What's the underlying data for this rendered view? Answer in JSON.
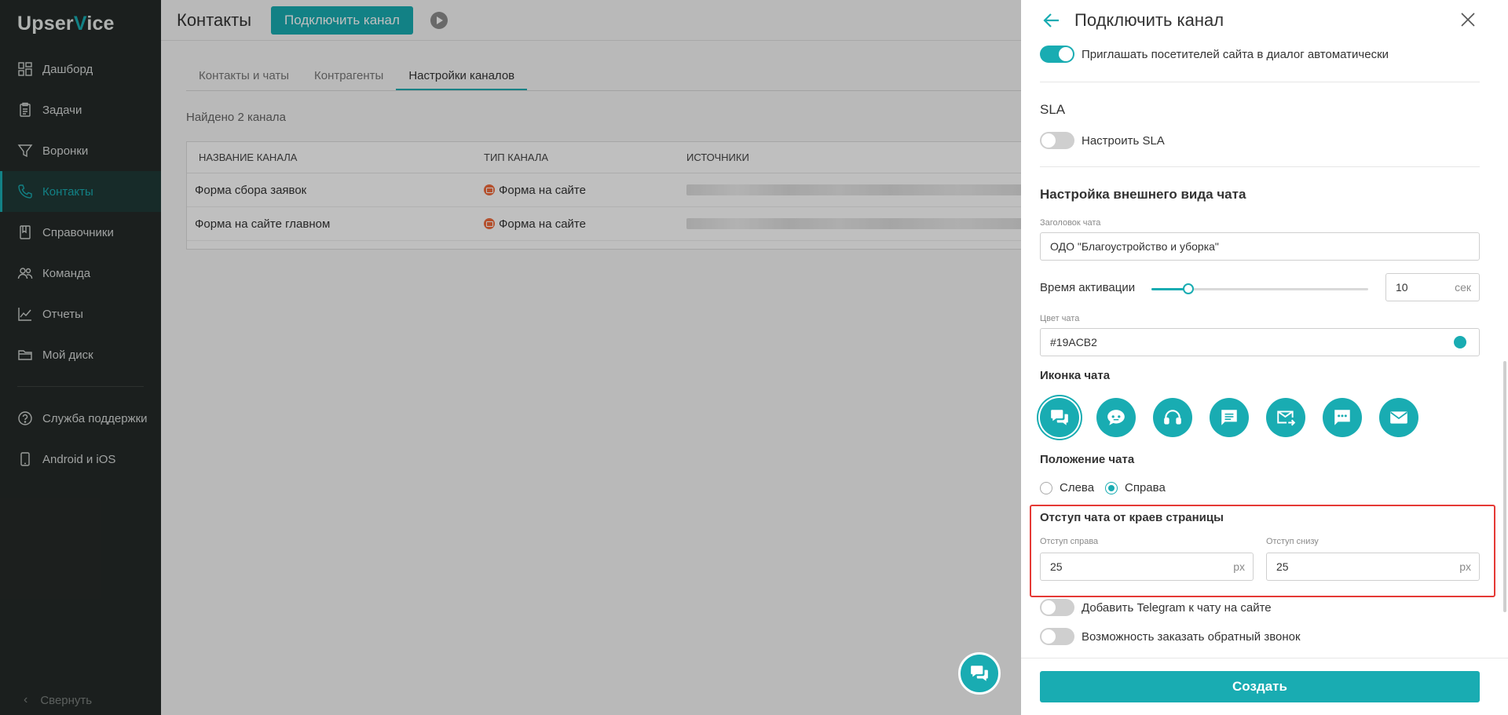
{
  "app": {
    "logo_left": "Upser",
    "logo_accent": "V",
    "logo_right": "ice"
  },
  "sidebar": {
    "items": [
      {
        "label": "Дашборд",
        "icon": "grid-icon"
      },
      {
        "label": "Задачи",
        "icon": "clipboard-icon"
      },
      {
        "label": "Воронки",
        "icon": "funnel-icon"
      },
      {
        "label": "Контакты",
        "icon": "phone-icon",
        "active": true
      },
      {
        "label": "Справочники",
        "icon": "book-icon"
      },
      {
        "label": "Команда",
        "icon": "team-icon"
      },
      {
        "label": "Отчеты",
        "icon": "chart-icon"
      },
      {
        "label": "Мой диск",
        "icon": "folder-icon"
      }
    ],
    "bottom_items": [
      {
        "label": "Служба поддержки",
        "icon": "help-icon"
      },
      {
        "label": "Android и iOS",
        "icon": "mobile-icon"
      }
    ],
    "collapse_label": "Свернуть"
  },
  "main": {
    "title": "Контакты",
    "connect_button": "Подключить канал",
    "tabs": [
      "Контакты и чаты",
      "Контрагенты",
      "Настройки каналов"
    ],
    "active_tab": "Настройки каналов",
    "found_text": "Найдено 2 канала",
    "table": {
      "headers": [
        "НАЗВАНИЕ КАНАЛА",
        "ТИП КАНАЛА",
        "ИСТОЧНИКИ"
      ],
      "rows": [
        {
          "name": "Форма сбора заявок",
          "type": "Форма на сайте"
        },
        {
          "name": "Форма на сайте главном",
          "type": "Форма на сайте"
        }
      ]
    }
  },
  "panel": {
    "title": "Подключить канал",
    "invite_toggle": {
      "label": "Приглашать посетителей сайта в диалог автоматически",
      "on": true
    },
    "sla_heading": "SLA",
    "sla_toggle": {
      "label": "Настроить SLA",
      "on": false
    },
    "appearance_heading": "Настройка внешнего вида чата",
    "chat_title_label": "Заголовок чата",
    "chat_title_value": "ОДО \"Благоустройство и уборка\"",
    "activation_label": "Время активации",
    "activation_value": "10",
    "activation_unit": "сек",
    "activation_slider_fraction": 0.17,
    "color_label": "Цвет чата",
    "color_value": "#19ACB2",
    "accent_color": "#19acb2",
    "icon_heading": "Иконка чата",
    "chat_icons": [
      "chat-bubbles-icon",
      "chat-robot-icon",
      "headset-icon",
      "message-icon",
      "mail-forward-icon",
      "chat-dots-icon",
      "envelope-icon"
    ],
    "selected_icon_index": 0,
    "position_heading": "Положение чата",
    "position_options": [
      "Слева",
      "Справа"
    ],
    "position_selected": "Справа",
    "offset_heading": "Отступ чата от краев страницы",
    "offset_right_label": "Отступ справа",
    "offset_right_value": "25",
    "offset_bottom_label": "Отступ снизу",
    "offset_bottom_value": "25",
    "offset_unit": "px",
    "telegram_toggle": {
      "label": "Добавить Telegram к чату на сайте",
      "on": false
    },
    "callback_toggle": {
      "label": "Возможность заказать обратный звонок",
      "on": false
    },
    "create_button": "Создать"
  }
}
